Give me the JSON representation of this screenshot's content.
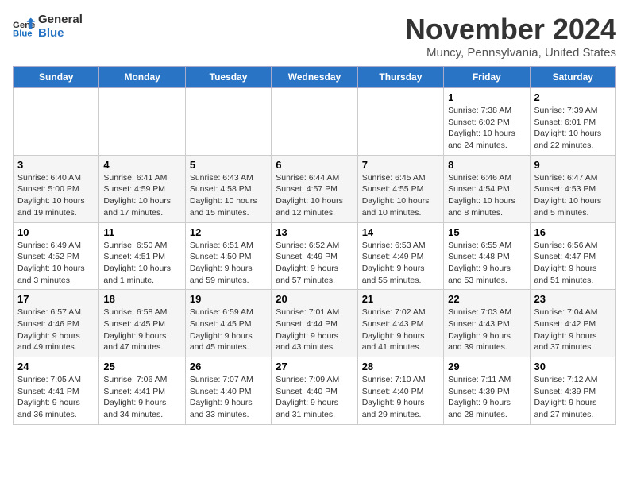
{
  "logo": {
    "line1": "General",
    "line2": "Blue"
  },
  "title": "November 2024",
  "location": "Muncy, Pennsylvania, United States",
  "days_of_week": [
    "Sunday",
    "Monday",
    "Tuesday",
    "Wednesday",
    "Thursday",
    "Friday",
    "Saturday"
  ],
  "weeks": [
    [
      {
        "day": "",
        "info": ""
      },
      {
        "day": "",
        "info": ""
      },
      {
        "day": "",
        "info": ""
      },
      {
        "day": "",
        "info": ""
      },
      {
        "day": "",
        "info": ""
      },
      {
        "day": "1",
        "info": "Sunrise: 7:38 AM\nSunset: 6:02 PM\nDaylight: 10 hours and 24 minutes."
      },
      {
        "day": "2",
        "info": "Sunrise: 7:39 AM\nSunset: 6:01 PM\nDaylight: 10 hours and 22 minutes."
      }
    ],
    [
      {
        "day": "3",
        "info": "Sunrise: 6:40 AM\nSunset: 5:00 PM\nDaylight: 10 hours and 19 minutes."
      },
      {
        "day": "4",
        "info": "Sunrise: 6:41 AM\nSunset: 4:59 PM\nDaylight: 10 hours and 17 minutes."
      },
      {
        "day": "5",
        "info": "Sunrise: 6:43 AM\nSunset: 4:58 PM\nDaylight: 10 hours and 15 minutes."
      },
      {
        "day": "6",
        "info": "Sunrise: 6:44 AM\nSunset: 4:57 PM\nDaylight: 10 hours and 12 minutes."
      },
      {
        "day": "7",
        "info": "Sunrise: 6:45 AM\nSunset: 4:55 PM\nDaylight: 10 hours and 10 minutes."
      },
      {
        "day": "8",
        "info": "Sunrise: 6:46 AM\nSunset: 4:54 PM\nDaylight: 10 hours and 8 minutes."
      },
      {
        "day": "9",
        "info": "Sunrise: 6:47 AM\nSunset: 4:53 PM\nDaylight: 10 hours and 5 minutes."
      }
    ],
    [
      {
        "day": "10",
        "info": "Sunrise: 6:49 AM\nSunset: 4:52 PM\nDaylight: 10 hours and 3 minutes."
      },
      {
        "day": "11",
        "info": "Sunrise: 6:50 AM\nSunset: 4:51 PM\nDaylight: 10 hours and 1 minute."
      },
      {
        "day": "12",
        "info": "Sunrise: 6:51 AM\nSunset: 4:50 PM\nDaylight: 9 hours and 59 minutes."
      },
      {
        "day": "13",
        "info": "Sunrise: 6:52 AM\nSunset: 4:49 PM\nDaylight: 9 hours and 57 minutes."
      },
      {
        "day": "14",
        "info": "Sunrise: 6:53 AM\nSunset: 4:49 PM\nDaylight: 9 hours and 55 minutes."
      },
      {
        "day": "15",
        "info": "Sunrise: 6:55 AM\nSunset: 4:48 PM\nDaylight: 9 hours and 53 minutes."
      },
      {
        "day": "16",
        "info": "Sunrise: 6:56 AM\nSunset: 4:47 PM\nDaylight: 9 hours and 51 minutes."
      }
    ],
    [
      {
        "day": "17",
        "info": "Sunrise: 6:57 AM\nSunset: 4:46 PM\nDaylight: 9 hours and 49 minutes."
      },
      {
        "day": "18",
        "info": "Sunrise: 6:58 AM\nSunset: 4:45 PM\nDaylight: 9 hours and 47 minutes."
      },
      {
        "day": "19",
        "info": "Sunrise: 6:59 AM\nSunset: 4:45 PM\nDaylight: 9 hours and 45 minutes."
      },
      {
        "day": "20",
        "info": "Sunrise: 7:01 AM\nSunset: 4:44 PM\nDaylight: 9 hours and 43 minutes."
      },
      {
        "day": "21",
        "info": "Sunrise: 7:02 AM\nSunset: 4:43 PM\nDaylight: 9 hours and 41 minutes."
      },
      {
        "day": "22",
        "info": "Sunrise: 7:03 AM\nSunset: 4:43 PM\nDaylight: 9 hours and 39 minutes."
      },
      {
        "day": "23",
        "info": "Sunrise: 7:04 AM\nSunset: 4:42 PM\nDaylight: 9 hours and 37 minutes."
      }
    ],
    [
      {
        "day": "24",
        "info": "Sunrise: 7:05 AM\nSunset: 4:41 PM\nDaylight: 9 hours and 36 minutes."
      },
      {
        "day": "25",
        "info": "Sunrise: 7:06 AM\nSunset: 4:41 PM\nDaylight: 9 hours and 34 minutes."
      },
      {
        "day": "26",
        "info": "Sunrise: 7:07 AM\nSunset: 4:40 PM\nDaylight: 9 hours and 33 minutes."
      },
      {
        "day": "27",
        "info": "Sunrise: 7:09 AM\nSunset: 4:40 PM\nDaylight: 9 hours and 31 minutes."
      },
      {
        "day": "28",
        "info": "Sunrise: 7:10 AM\nSunset: 4:40 PM\nDaylight: 9 hours and 29 minutes."
      },
      {
        "day": "29",
        "info": "Sunrise: 7:11 AM\nSunset: 4:39 PM\nDaylight: 9 hours and 28 minutes."
      },
      {
        "day": "30",
        "info": "Sunrise: 7:12 AM\nSunset: 4:39 PM\nDaylight: 9 hours and 27 minutes."
      }
    ]
  ]
}
